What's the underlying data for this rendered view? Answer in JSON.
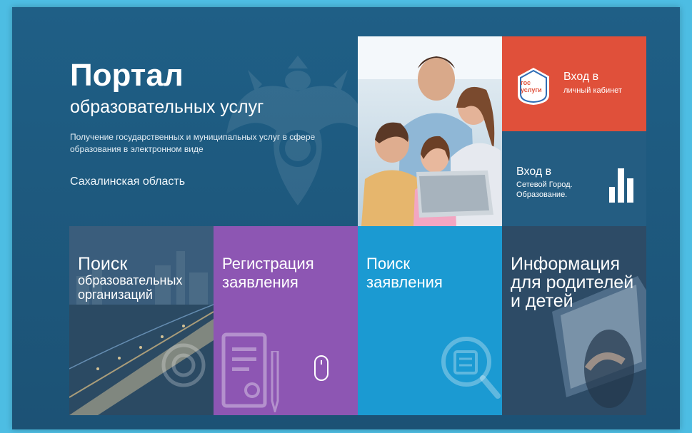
{
  "hero": {
    "title": "Портал",
    "subtitle": "образовательных услуг",
    "description": "Получение государственных и муниципальных услуг в сфере образования в электронном виде",
    "region": "Сахалинская область"
  },
  "gosuslugi": {
    "badge_line1": "гос",
    "badge_line2": "услуги",
    "title": "Вход в",
    "subtitle": "личный кабинет"
  },
  "network_city": {
    "title": "Вход в",
    "subtitle_line1": "Сетевой Город.",
    "subtitle_line2": "Образование."
  },
  "tiles": {
    "search_org": {
      "line1": "Поиск",
      "line2": "образовательных",
      "line3": "организаций"
    },
    "register": {
      "line1": "Регистрация",
      "line2": "заявления"
    },
    "search_app": {
      "line1": "Поиск",
      "line2": "заявления"
    },
    "info": {
      "line1": "Информация",
      "line2": "для родителей",
      "line3": "и детей"
    }
  },
  "icons": [
    "emblem-icon",
    "gosuslugi-icon",
    "network-city-icon",
    "document-icon",
    "pen-icon",
    "mouse-icon",
    "search-document-icon",
    "target-icon"
  ],
  "colors": {
    "background": "#4dbde3",
    "panel": "#1f5f86",
    "gosuslugi": "#e0503a",
    "register": "#8d56b3",
    "search_app": "#1b9ad2"
  }
}
